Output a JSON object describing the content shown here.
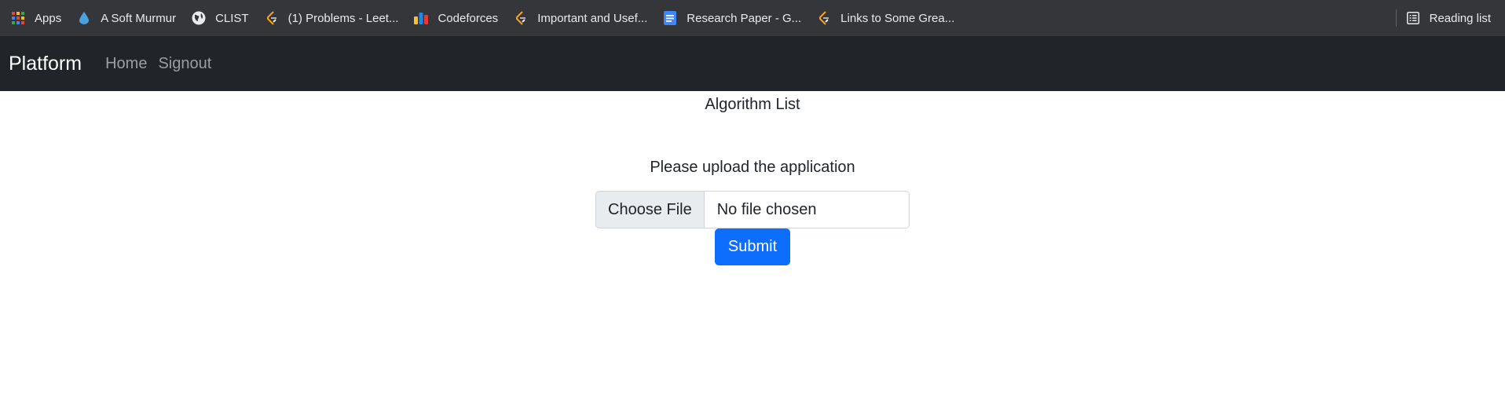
{
  "bookmarks_bar": {
    "items": [
      {
        "label": "Apps",
        "icon": "apps-grid-icon"
      },
      {
        "label": "A Soft Murmur",
        "icon": "water-drop-icon"
      },
      {
        "label": "CLIST",
        "icon": "globe-icon"
      },
      {
        "label": "(1) Problems - Leet...",
        "icon": "leetcode-icon"
      },
      {
        "label": "Codeforces",
        "icon": "codeforces-icon"
      },
      {
        "label": "Important and Usef...",
        "icon": "leetcode-icon"
      },
      {
        "label": "Research Paper - G...",
        "icon": "google-docs-icon"
      },
      {
        "label": "Links to Some Grea...",
        "icon": "leetcode-icon"
      }
    ],
    "reading_list": "Reading list"
  },
  "navbar": {
    "brand": "Platform",
    "links": [
      "Home",
      "Signout"
    ]
  },
  "main": {
    "heading": "Algorithm List",
    "upload_prompt": "Please upload the application",
    "file_input": {
      "button_label": "Choose File",
      "status": "No file chosen"
    },
    "submit_label": "Submit"
  },
  "colors": {
    "bookmarks_bg": "#35363a",
    "navbar_bg": "#212529",
    "primary": "#0d6efd"
  }
}
